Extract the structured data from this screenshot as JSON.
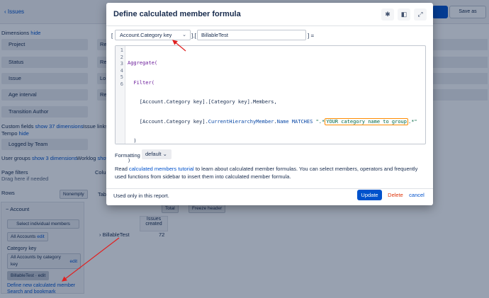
{
  "background": {
    "back_link": "Issues",
    "save_button": "",
    "save_as_button": "Save as",
    "dimensions_label": "Dimensions",
    "dimensions_hide": "hide",
    "dimensions": [
      "Project",
      "Status",
      "Issue",
      "Age interval",
      "Transition Author"
    ],
    "dimensions_right": [
      "Re",
      "Re",
      "Lo",
      "Re"
    ],
    "custom_fields_label": "Custom fields",
    "custom_fields_show": "show 37 dimensions",
    "issue_links_label": "Issue links",
    "tempo_label": "Tempo",
    "tempo_hide": "hide",
    "tempo_item": "Logged by Team",
    "user_groups_label": "User groups",
    "user_groups_show": "show 3 dimensions",
    "worklog_label": "Worklog",
    "worklog_show": "show",
    "page_filters_label": "Page filters",
    "page_filters_hint": "Drag here if needed",
    "columns_label": "Colu",
    "rows_label": "Rows",
    "nonempty_label": "Nonempty",
    "account_label": "Account",
    "select_members": "Select individual members",
    "all_accounts": "All Accounts",
    "all_accounts_edit": "edit",
    "category_key_label": "Category key",
    "all_by_category": "All Accounts by category key",
    "all_by_category_edit": "edit",
    "billable_test_chip": "BillableTest",
    "billable_test_chip_edit": "edit",
    "define_new": "Define new calculated member",
    "search_bookmark": "Search and bookmark",
    "tab_label": "Tab",
    "total_label": "Total",
    "freeze_header": "Freeze header",
    "table_col_header": "Issues created",
    "table_row_label": "BillableTest",
    "table_row_value": "72"
  },
  "modal": {
    "title": "Define calculated member formula",
    "dimension_select": "Account.Category key",
    "name_value": "BillableTest",
    "bracket_open": "[",
    "bracket_mid": "].[",
    "bracket_close": "] =",
    "code_lines": [
      "1",
      "2",
      "3",
      "4",
      "5",
      "6"
    ],
    "code": {
      "l1": "Aggregate(",
      "l2_indent": "  ",
      "l2": "Filter(",
      "l3_indent": "    ",
      "l3": "[Account.Category key].[Category key].Members,",
      "l4_indent": "    ",
      "l4_a": "[Account.Category key].",
      "l4_b": "CurrentHierarchyMember",
      "l4_c": ".",
      "l4_d": "Name",
      "l4_e": " MATCHES ",
      "l4_f": "\".*",
      "l4_highlight": "YOUR category name to group",
      "l4_g": ".*\"",
      "l5": "  )",
      "l6": ")"
    },
    "formatting_label": "Formatting",
    "formatting_value": "default",
    "help_prefix": "Read ",
    "help_link": "calculated members tutorial",
    "help_suffix": " to learn about calculated member formulas. You can select members, operators and frequently used functions from sidebar to insert them into calculated member formula.",
    "footer_note": "Used only in this report.",
    "update_button": "Update",
    "delete_button": "Delete",
    "cancel_button": "cancel"
  },
  "colors": {
    "primary": "#0052cc",
    "danger": "#de350b",
    "highlight": "#ff8b00",
    "annotation_arrow": "#e02020"
  }
}
